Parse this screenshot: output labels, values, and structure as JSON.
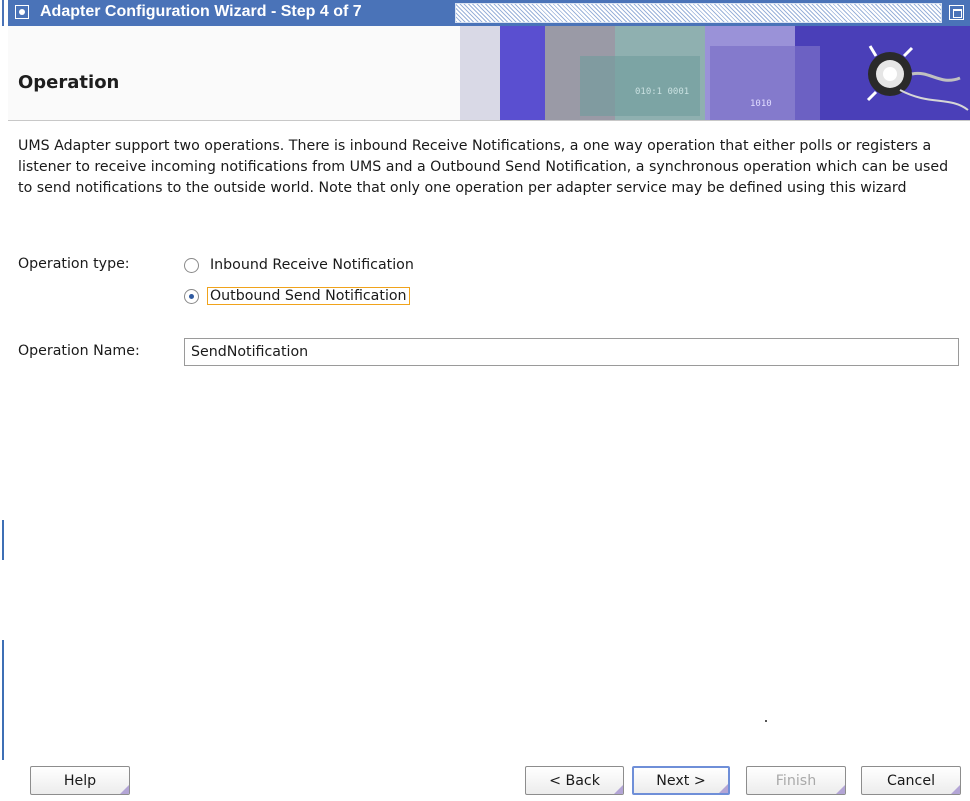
{
  "window": {
    "title": "Adapter Configuration Wizard - Step 4 of 7"
  },
  "header": {
    "page_title": "Operation"
  },
  "description": "UMS Adapter support two operations. There is inbound Receive Notifications, a one way operation that either polls or registers a listener to receive incoming notifications from UMS and a Outbound Send Notification, a synchronous operation which can be used to send notifications to the outside world. Note that only one operation per adapter service may be defined using this wizard",
  "operation_type": {
    "label": "Operation type:",
    "options": [
      {
        "label": "Inbound Receive Notification",
        "selected": false
      },
      {
        "label": "Outbound Send Notification",
        "selected": true
      }
    ]
  },
  "operation_name": {
    "label": "Operation Name:",
    "value": "SendNotification"
  },
  "buttons": {
    "help": "Help",
    "back": "< Back",
    "next": "Next >",
    "finish": "Finish",
    "cancel": "Cancel"
  },
  "colors": {
    "titlebar": "#4a73b8",
    "focus_outline": "#f0a31c",
    "button_focus": "#6f8fd8"
  }
}
